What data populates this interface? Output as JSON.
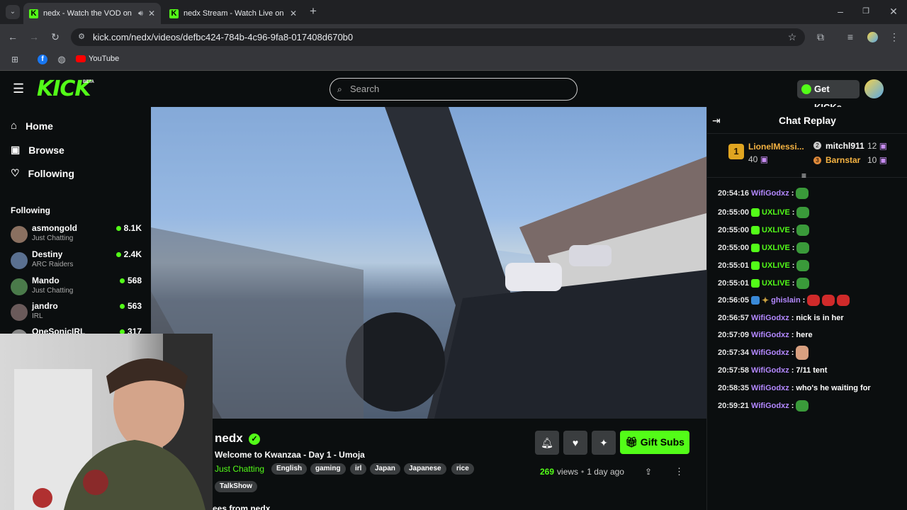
{
  "browser": {
    "tabs": [
      {
        "title": "nedx - Watch the VOD on Kick"
      },
      {
        "title": "nedx Stream - Watch Live on Kick"
      }
    ],
    "url": "kick.com/nedx/videos/defbc424-784b-4c96-9fa8-017408d670b0",
    "bookmarks": [
      {
        "label": "YouTube"
      }
    ]
  },
  "header": {
    "logo": "KICK",
    "beta": "BETA",
    "search_placeholder": "Search",
    "get_kicks": "Get KICKs"
  },
  "sidebar": {
    "nav": [
      {
        "label": "Home"
      },
      {
        "label": "Browse"
      },
      {
        "label": "Following"
      }
    ],
    "following_title": "Following",
    "following": [
      {
        "name": "asmongold",
        "category": "Just Chatting",
        "viewers": "8.1K"
      },
      {
        "name": "Destiny",
        "category": "ARC Raiders",
        "viewers": "2.4K"
      },
      {
        "name": "Mando",
        "category": "Just Chatting",
        "viewers": "568"
      },
      {
        "name": "jandro",
        "category": "IRL",
        "viewers": "563"
      },
      {
        "name": "OneSonicIRL",
        "category": "",
        "viewers": "317"
      }
    ]
  },
  "video": {
    "channel": "nedx",
    "title": "Welcome to Kwanzaa - Day 1 - Umoja",
    "category": "Just Chatting",
    "tags": [
      "English",
      "gaming",
      "irl",
      "Japan",
      "Japanese",
      "rice",
      "TalkShow"
    ],
    "views": "269",
    "views_label": "views",
    "age": "1 day ago",
    "gift_subs": "Gift Subs",
    "more_from": "ees from nedx"
  },
  "chat": {
    "title": "Chat Replay",
    "top_gifters": [
      {
        "rank": "1",
        "name": "LionelMessi...",
        "count": "40"
      },
      {
        "rank": "2",
        "name": "mitchl911",
        "count": "12"
      },
      {
        "rank": "3",
        "name": "Barnstar",
        "count": "10"
      }
    ],
    "messages": [
      {
        "time": "20:54:16",
        "user": "WifiGodxz",
        "text": "",
        "emote": true
      },
      {
        "time": "20:55:00",
        "user": "UXLIVE",
        "text": "",
        "emote": true
      },
      {
        "time": "20:55:00",
        "user": "UXLIVE",
        "text": "",
        "emote": true
      },
      {
        "time": "20:55:00",
        "user": "UXLIVE",
        "text": "",
        "emote": true
      },
      {
        "time": "20:55:01",
        "user": "UXLIVE",
        "text": "",
        "emote": true
      },
      {
        "time": "20:55:01",
        "user": "UXLIVE",
        "text": "",
        "emote": true
      },
      {
        "time": "20:56:05",
        "user": "ghislain",
        "text": "",
        "emote": true
      },
      {
        "time": "20:56:57",
        "user": "WifiGodxz",
        "text": "nick is in her",
        "emote": false
      },
      {
        "time": "20:57:09",
        "user": "WifiGodxz",
        "text": "here",
        "emote": false
      },
      {
        "time": "20:57:34",
        "user": "WifiGodxz",
        "text": "",
        "emote": true
      },
      {
        "time": "20:57:58",
        "user": "WifiGodxz",
        "text": "7/11 tent",
        "emote": false
      },
      {
        "time": "20:58:35",
        "user": "WifiGodxz",
        "text": "who's he waiting for",
        "emote": false
      },
      {
        "time": "20:59:21",
        "user": "WifiGodxz",
        "text": "",
        "emote": true
      }
    ],
    "colors": {
      "purple": "#b388ff",
      "green": "#53fc18",
      "gold": "#f5b342"
    }
  }
}
